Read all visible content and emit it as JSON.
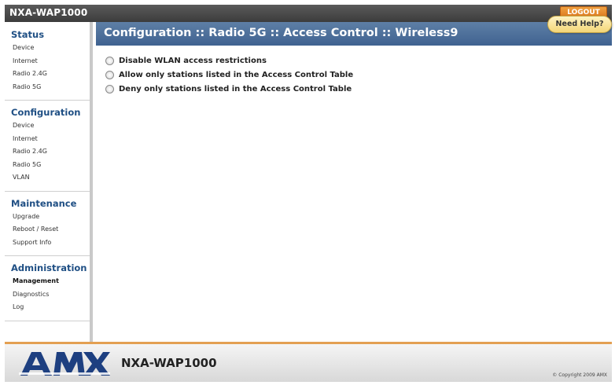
{
  "app": {
    "title": "NXA-WAP1000",
    "logout_label": "LOGOUT"
  },
  "sidebar": {
    "sections": [
      {
        "heading": "Status",
        "items": [
          "Device",
          "Internet",
          "Radio 2.4G",
          "Radio 5G"
        ]
      },
      {
        "heading": "Configuration",
        "items": [
          "Device",
          "Internet",
          "Radio 2.4G",
          "Radio 5G",
          "VLAN"
        ]
      },
      {
        "heading": "Maintenance",
        "items": [
          "Upgrade",
          "Reboot / Reset",
          "Support Info"
        ]
      },
      {
        "heading": "Administration",
        "items": [
          "Management",
          "Diagnostics",
          "Log"
        ]
      }
    ]
  },
  "page": {
    "title": "Configuration :: Radio 5G :: Access Control :: Wireless9",
    "help_label": "Need Help?"
  },
  "options": [
    "Disable WLAN access restrictions",
    "Allow only stations listed in the Access Control Table",
    "Deny only stations listed in the Access Control Table"
  ],
  "footer": {
    "logo_text": "AMX",
    "model": "NXA-WAP1000",
    "copyright": "© Copyright 2009 AMX"
  },
  "colors": {
    "header_blue": "#4a6d99",
    "accent_orange": "#e07b1f",
    "logo_blue": "#1d3f80"
  }
}
